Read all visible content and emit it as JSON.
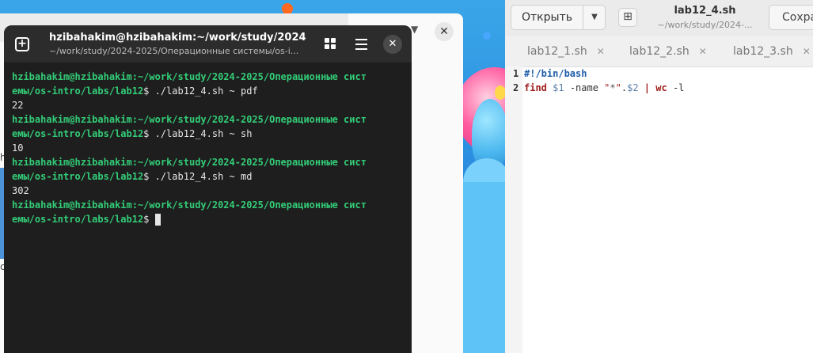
{
  "terminal": {
    "title": "hzibahakim@hzibahakim:~/work/study/2024...",
    "subtitle": "~/work/study/2024-2025/Операционные системы/os-i...",
    "lines": [
      {
        "prompt_1": "hzibahakim@hzibahakim:~/work/study/2024-2025/Операционные сист",
        "prompt_2": "емы/os-intro/labs/lab12",
        "command": "$ ./lab12_4.sh ~ pdf",
        "output": "22"
      },
      {
        "prompt_1": "hzibahakim@hzibahakim:~/work/study/2024-2025/Операционные сист",
        "prompt_2": "емы/os-intro/labs/lab12",
        "command": "$ ./lab12_4.sh ~ sh",
        "output": "10"
      },
      {
        "prompt_1": "hzibahakim@hzibahakim:~/work/study/2024-2025/Операционные сист",
        "prompt_2": "емы/os-intro/labs/lab12",
        "command": "$ ./lab12_4.sh ~ md",
        "output": "302"
      }
    ],
    "last_prompt_1": "hzibahakim@hzibahakim:~/work/study/2024-2025/Операционные сист",
    "last_prompt_2": "емы/os-intro/labs/lab12",
    "last_dollar": "$ "
  },
  "editor": {
    "open_label": "Открыть",
    "title": "lab12_4.sh",
    "path": "~/work/study/2024-...",
    "save_label": "Сохра",
    "tabs": [
      {
        "label": "lab12_1.sh"
      },
      {
        "label": "lab12_2.sh"
      },
      {
        "label": "lab12_3.sh"
      }
    ],
    "line_numbers": [
      "1",
      "2"
    ],
    "code": {
      "line1": "#!/bin/bash",
      "find": "find",
      "arg1": "$1",
      "name_opt": " -name ",
      "q_open": "\"",
      "star": "*",
      "q_close": "\"",
      "dot": ".",
      "arg2": "$2",
      "pipe": "|",
      "wc": "wc",
      "wc_opt": " -l"
    }
  },
  "background_window": {
    "close_glyph": "✕",
    "side_char_1": "h",
    "side_char_2": "c"
  },
  "icons": {
    "terminal_newtab": "+",
    "terminal_close": "✕",
    "editor_dropdown": "▼",
    "editor_newdoc": "⊞",
    "tab_close": "✕"
  },
  "colors": {
    "prompt": "#33cc77",
    "terminal_bg": "#1e1e1e",
    "keyword": "#a0201e"
  }
}
